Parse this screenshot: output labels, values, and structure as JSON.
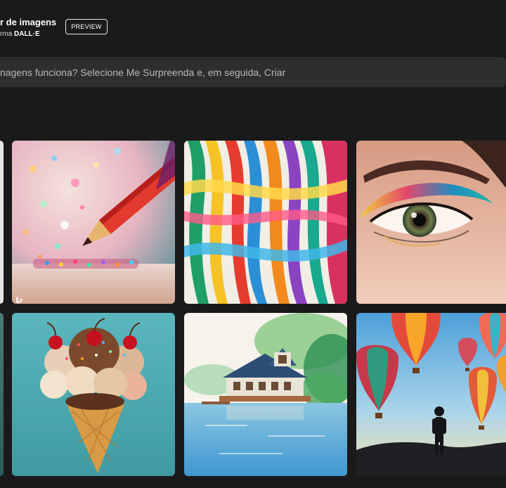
{
  "header": {
    "title": "r de imagens",
    "subtitle_prefix": "rma ",
    "subtitle_brand": "DALL·E",
    "preview_badge": "PREVIEW"
  },
  "prompt": {
    "placeholder": "nagens funciona? Selecione Me Surpreenda e, em seguida, Criar",
    "value": ""
  },
  "gallery": {
    "images": [
      {
        "subject": "colored-pencil-glitter"
      },
      {
        "subject": "colorful-ribbons"
      },
      {
        "subject": "eye-makeup"
      },
      {
        "subject": "ice-cream-cone"
      },
      {
        "subject": "lake-house-watercolor"
      },
      {
        "subject": "hot-air-balloons"
      }
    ]
  },
  "colors": {
    "background": "#1a1a1a",
    "prompt_bar": "#2e2e2e",
    "text": "#ffffff"
  }
}
